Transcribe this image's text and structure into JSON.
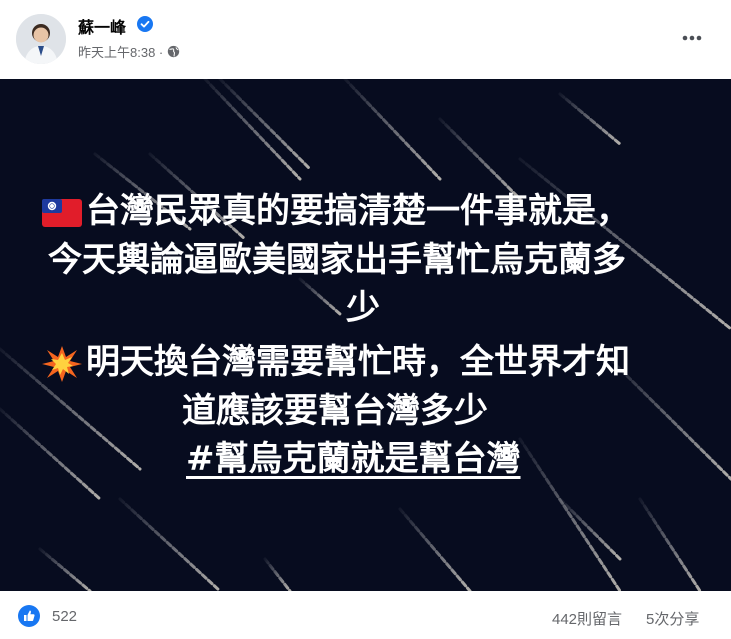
{
  "post": {
    "author": {
      "name": "蘇一峰",
      "verified_icon": "verified-badge-icon"
    },
    "timestamp": "昨天上午8:38 ·",
    "privacy_icon": "globe-icon",
    "more_icon": "more-options-icon",
    "image_text": {
      "line1": "台灣民眾真的要搞清楚一件事就是，",
      "line2": "今天輿論逼歐美國家出手幫忙烏克蘭多",
      "line3": "少",
      "line4": "明天換台灣需要幫忙時，全世界才知",
      "line5": "道應該要幫台灣多少",
      "hashtag": "#幫烏克蘭就是幫台灣"
    },
    "colors": {
      "image_background": "#070c1f",
      "accent_blue": "#1877f2",
      "secondary_text": "#65676b"
    }
  },
  "footer": {
    "reaction_icon": "like-icon",
    "reactions_count": "522",
    "comments": "442則留言",
    "shares": "5次分享"
  }
}
